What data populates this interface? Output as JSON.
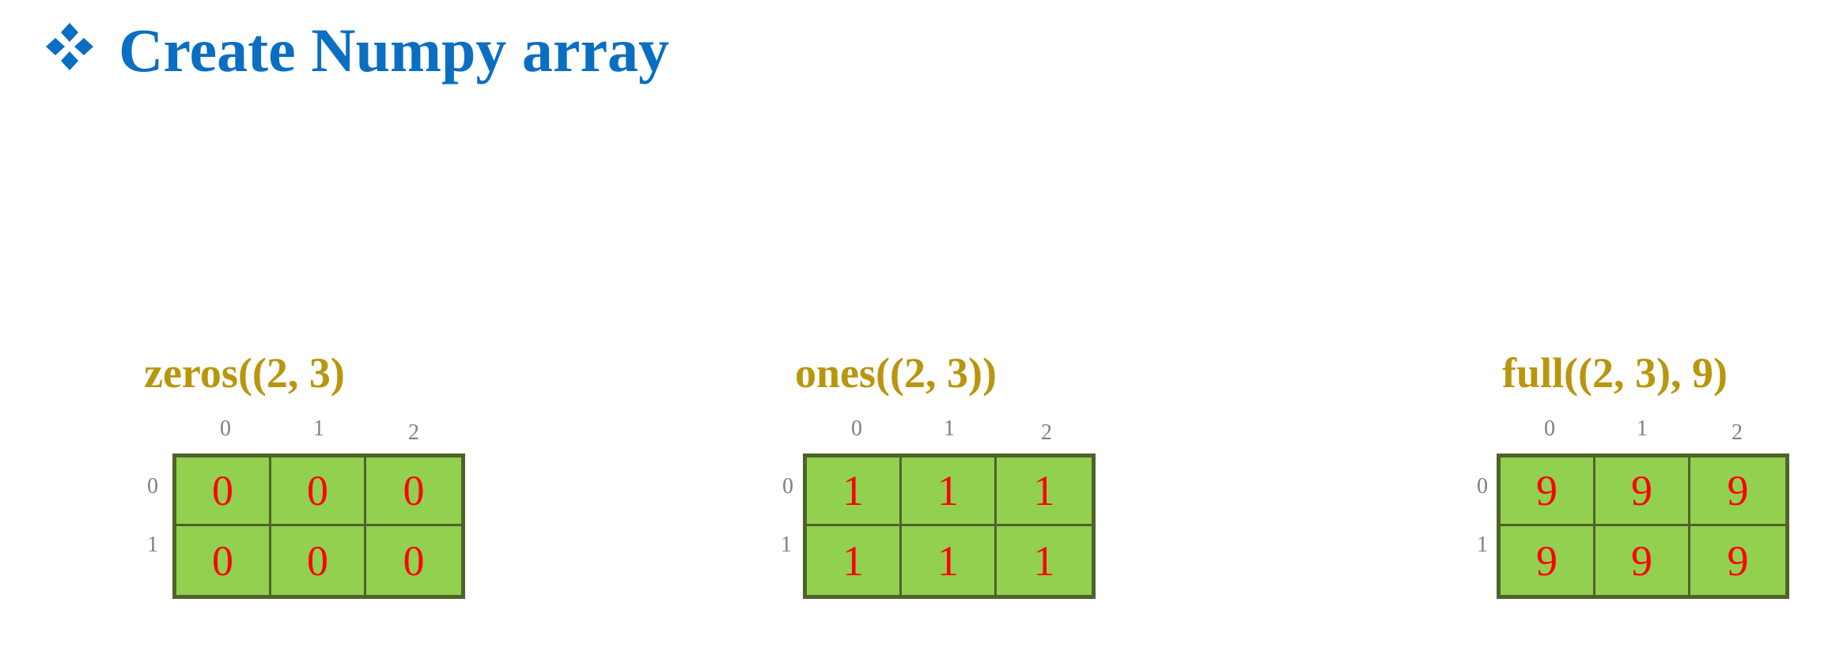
{
  "title": "Create Numpy array",
  "colors": {
    "title": "#0a6fc2",
    "label": "#b8960e",
    "index": "#808080",
    "cell_fill": "#92d050",
    "cell_border": "#4f6228",
    "cell_text": "#ff0000"
  },
  "title_icon": "four-diamond-bullet-icon",
  "arrays": [
    {
      "label": "zeros((2, 3)",
      "col_indices": [
        "0",
        "1",
        "2"
      ],
      "row_indices": [
        "0",
        "1"
      ],
      "values": [
        [
          "0",
          "0",
          "0"
        ],
        [
          "0",
          "0",
          "0"
        ]
      ]
    },
    {
      "label": "ones((2, 3))",
      "col_indices": [
        "0",
        "1",
        "2"
      ],
      "row_indices": [
        "0",
        "1"
      ],
      "values": [
        [
          "1",
          "1",
          "1"
        ],
        [
          "1",
          "1",
          "1"
        ]
      ]
    },
    {
      "label": "full((2, 3), 9)",
      "col_indices": [
        "0",
        "1",
        "2"
      ],
      "row_indices": [
        "0",
        "1"
      ],
      "values": [
        [
          "9",
          "9",
          "9"
        ],
        [
          "9",
          "9",
          "9"
        ]
      ]
    }
  ]
}
